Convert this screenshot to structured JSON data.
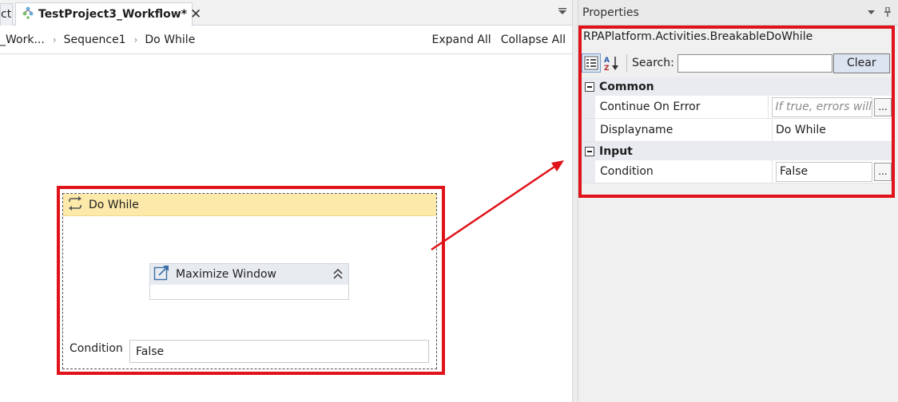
{
  "designer": {
    "tabs": [
      {
        "label": "ct"
      },
      {
        "label": "TestProject3_Workflow*",
        "close_icon": "close-icon"
      }
    ],
    "breadcrumb": [
      "_Work...",
      "Sequence1",
      "Do While"
    ],
    "breadcrumb_separator": "›",
    "expand_all": "Expand All",
    "collapse_all": "Collapse All",
    "activity": {
      "title": "Do While",
      "icon": "loop-icon",
      "child": {
        "title": "Maximize Window",
        "icon": "maximize-window-icon"
      },
      "condition_label": "Condition",
      "condition_value": "False"
    }
  },
  "properties": {
    "panel_title": "Properties",
    "type_name": "RPAPlatform.Activities.BreakableDoWhile",
    "search_label": "Search:",
    "search_value": "",
    "clear_label": "Clear",
    "categories": [
      {
        "name": "Common",
        "props": [
          {
            "name": "Continue On Error",
            "value": "If true, errors will",
            "placeholder": true,
            "has_ellipsis": true
          },
          {
            "name": "Displayname",
            "value": "Do While",
            "placeholder": false,
            "has_ellipsis": false
          }
        ]
      },
      {
        "name": "Input",
        "props": [
          {
            "name": "Condition",
            "value": "False",
            "placeholder": false,
            "has_ellipsis": true
          }
        ]
      }
    ],
    "ellipsis_label": "..."
  },
  "colors": {
    "highlight": "#e0131a",
    "activity_header": "#fde9a9",
    "clear_button": "#dce4f1"
  }
}
